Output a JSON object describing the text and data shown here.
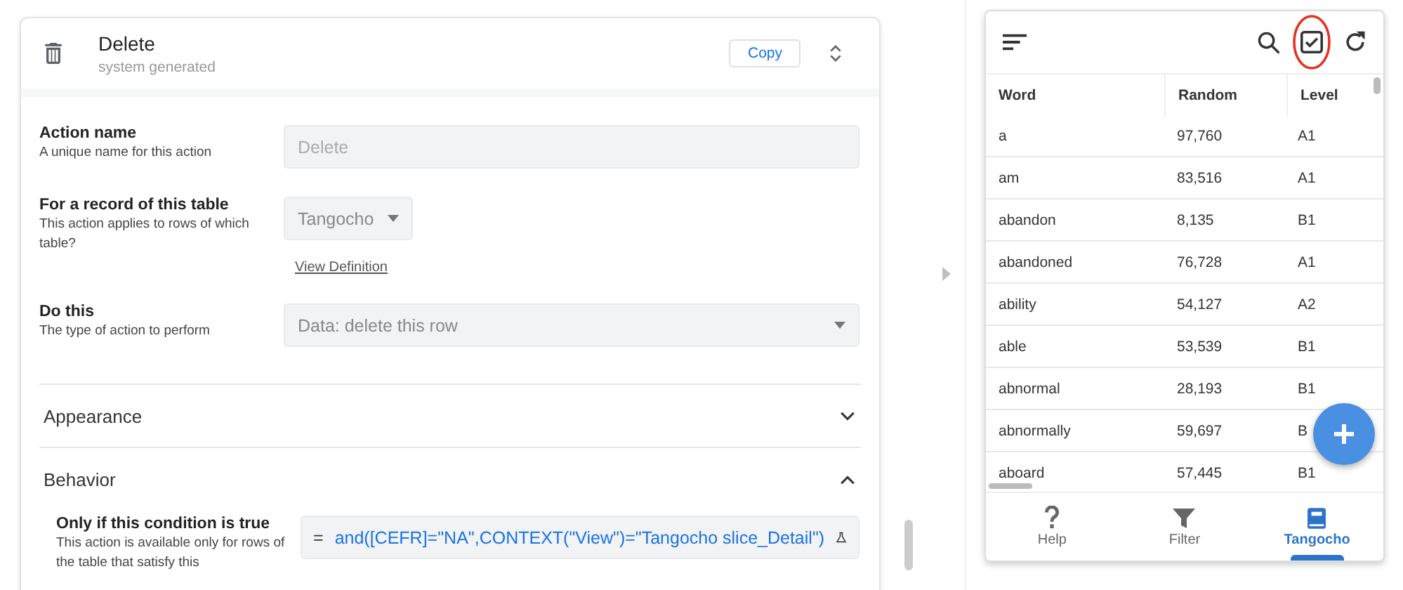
{
  "action_card": {
    "title": "Delete",
    "subtitle": "system generated",
    "copy_button": "Copy"
  },
  "fields": [
    {
      "kind": "text",
      "label": "Action name",
      "hint": "A unique name for this action",
      "value": "Delete"
    },
    {
      "kind": "select_small",
      "label": "For a record of this table",
      "hint": "This action applies to rows of which table?",
      "value": "Tangocho",
      "link": "View Definition"
    },
    {
      "kind": "select_wide",
      "label": "Do this",
      "hint": "The type of action to perform",
      "value": "Data: delete this row"
    }
  ],
  "sections": [
    {
      "title": "Appearance",
      "expanded": false
    },
    {
      "title": "Behavior",
      "expanded": true
    }
  ],
  "condition": {
    "label": "Only if this condition is true",
    "hint": "This action is available only for rows of the table that satisfy this",
    "prefix": "=",
    "expression": "and([CEFR]=\"NA\",CONTEXT(\"View\")=\"Tangocho slice_Detail\")"
  },
  "preview": {
    "columns": [
      "Word",
      "Random",
      "Level"
    ],
    "rows": [
      [
        "a",
        "97,760",
        "A1"
      ],
      [
        "am",
        "83,516",
        "A1"
      ],
      [
        "abandon",
        "8,135",
        "B1"
      ],
      [
        "abandoned",
        "76,728",
        "A1"
      ],
      [
        "ability",
        "54,127",
        "A2"
      ],
      [
        "able",
        "53,539",
        "B1"
      ],
      [
        "abnormal",
        "28,193",
        "B1"
      ],
      [
        "abnormally",
        "59,697",
        "B"
      ],
      [
        "aboard",
        "57,445",
        "B1"
      ]
    ],
    "nav": [
      {
        "kind": "help",
        "label": "Help",
        "selected": false
      },
      {
        "kind": "filter",
        "label": "Filter",
        "selected": false
      },
      {
        "kind": "book",
        "label": "Tangocho",
        "selected": true
      }
    ]
  }
}
